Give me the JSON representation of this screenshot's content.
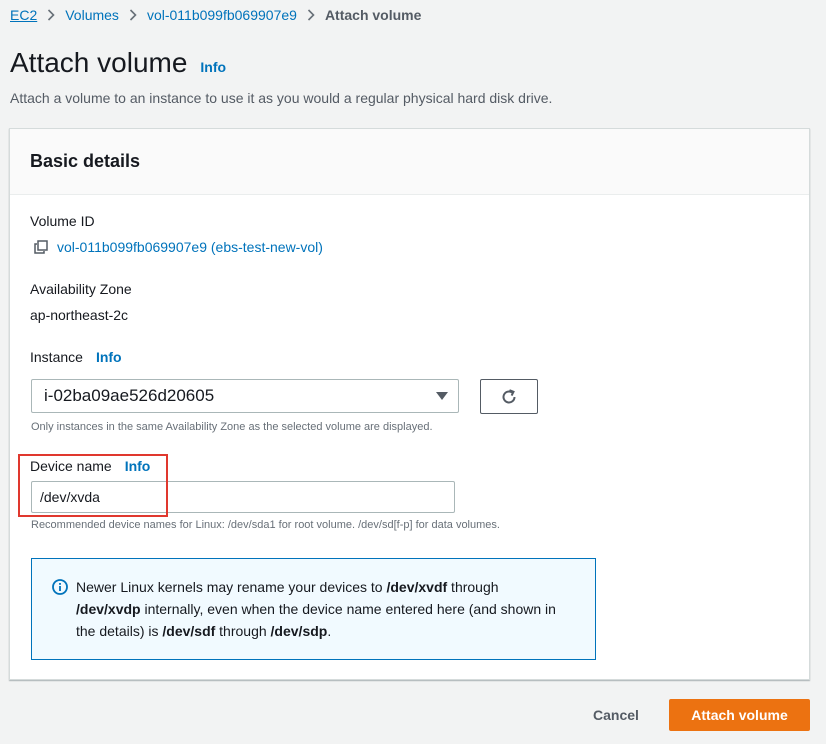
{
  "breadcrumb": {
    "items": [
      {
        "label": "EC2"
      },
      {
        "label": "Volumes"
      },
      {
        "label": "vol-011b099fb069907e9"
      }
    ],
    "current": "Attach volume"
  },
  "page": {
    "title": "Attach volume",
    "info_label": "Info",
    "description": "Attach a volume to an instance to use it as you would a regular physical hard disk drive."
  },
  "panel": {
    "title": "Basic details",
    "volume_id": {
      "label": "Volume ID",
      "value": "vol-011b099fb069907e9 (ebs-test-new-vol)",
      "icon": "copy-icon"
    },
    "availability_zone": {
      "label": "Availability Zone",
      "value": "ap-northeast-2c"
    },
    "instance": {
      "label": "Instance",
      "info_label": "Info",
      "selected": "i-02ba09ae526d20605",
      "hint": "Only instances in the same Availability Zone as the selected volume are displayed.",
      "refresh_icon": "refresh-icon"
    },
    "device_name": {
      "label": "Device name",
      "info_label": "Info",
      "value": "/dev/xvda",
      "hint": "Recommended device names for Linux: /dev/sda1 for root volume. /dev/sd[f-p] for data volumes."
    },
    "alert": {
      "icon": "info-circle-icon",
      "text_1": "Newer Linux kernels may rename your devices to ",
      "bold_1": "/dev/xvdf",
      "text_2": " through ",
      "bold_2": "/dev/xvdp",
      "text_3": " internally, even when the device name entered here (and shown in the details) is ",
      "bold_3": "/dev/sdf",
      "text_4": " through ",
      "bold_4": "/dev/sdp",
      "text_5": "."
    }
  },
  "actions": {
    "cancel_label": "Cancel",
    "attach_label": "Attach volume"
  },
  "colors": {
    "link": "#0073bb",
    "primary_button": "#ec7211",
    "highlight": "#e0382e"
  }
}
